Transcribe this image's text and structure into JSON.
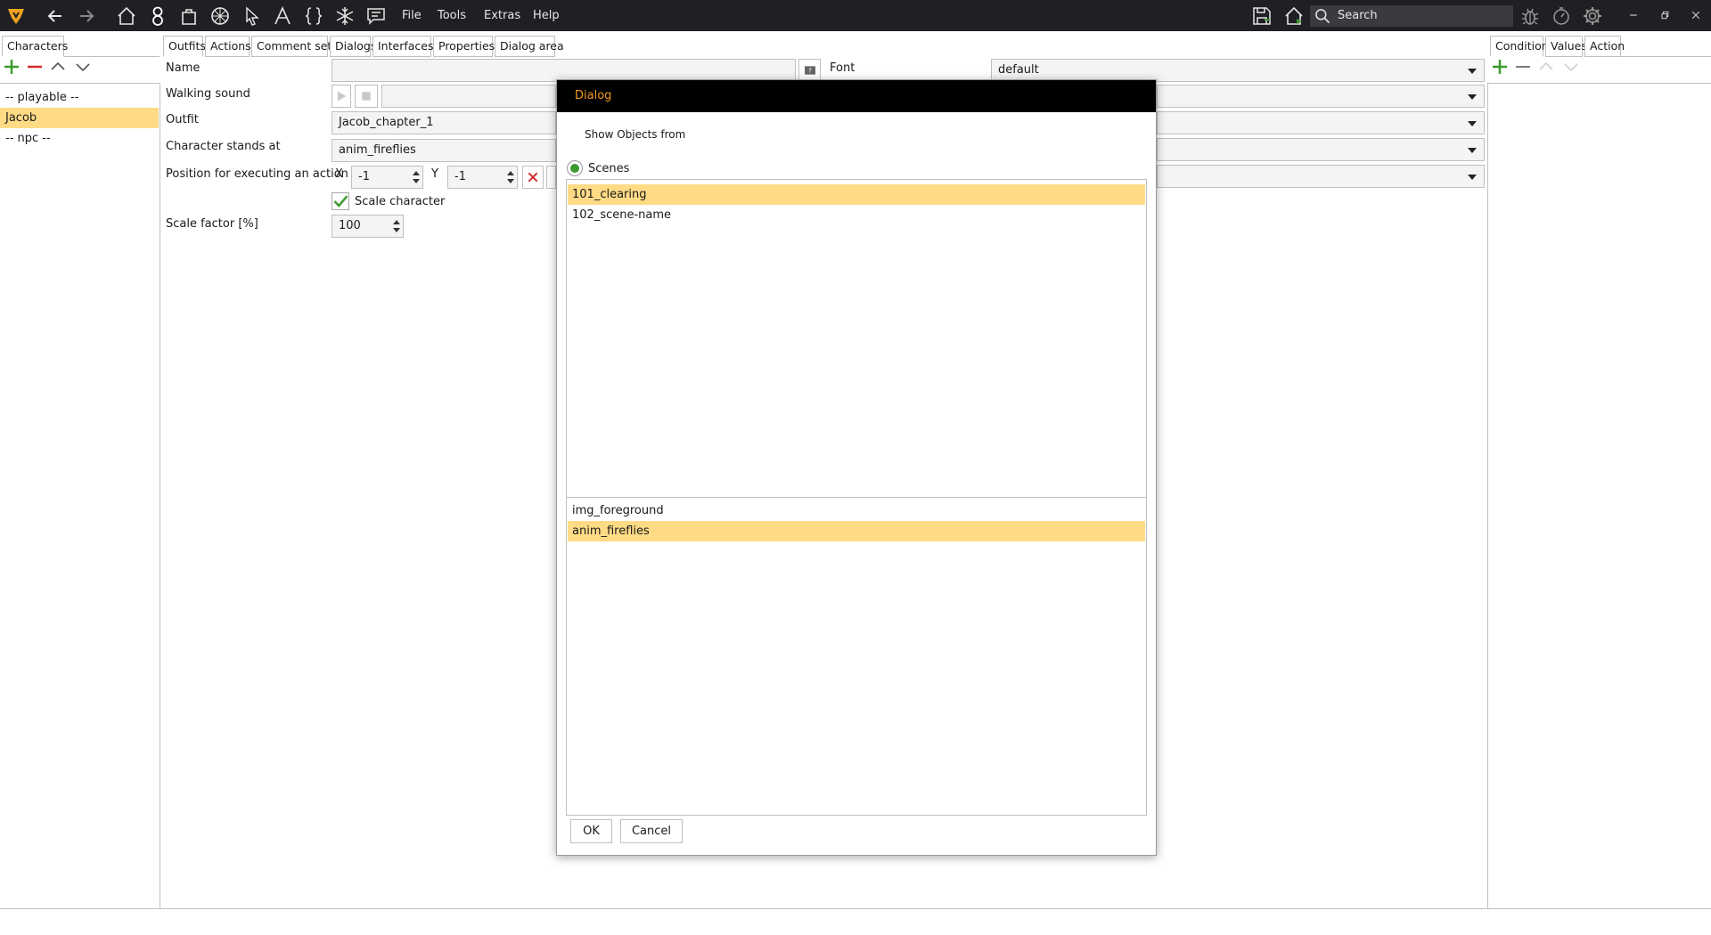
{
  "menu": {
    "file": "File",
    "tools": "Tools",
    "extras": "Extras",
    "help": "Help"
  },
  "search": {
    "placeholder": "Search"
  },
  "left_panel": {
    "tab": "Characters",
    "items": [
      {
        "label": "-- playable --"
      },
      {
        "label": "Jacob"
      },
      {
        "label": "-- npc --"
      }
    ]
  },
  "center_tabs": [
    "Outfits",
    "Actions",
    "Comment sets",
    "Dialogs",
    "Interfaces",
    "Properties",
    "Dialog area"
  ],
  "form": {
    "name_label": "Name",
    "name_value": "",
    "walking_sound_label": "Walking sound",
    "outfit_label": "Outfit",
    "outfit_value": "Jacob_chapter_1",
    "stands_at_label": "Character stands at",
    "stands_at_value": "anim_fireflies",
    "position_label": "Position for executing an action",
    "x_label": "X",
    "x_value": "-1",
    "y_label": "Y",
    "y_value": "-1",
    "scale_character_label": "Scale character",
    "scale_character_checked": true,
    "scale_factor_label": "Scale factor [%]",
    "scale_factor_value": "100",
    "font_label": "Font",
    "font_value": "default"
  },
  "right_panel": {
    "tabs": [
      "Conditions",
      "Values",
      "Action"
    ]
  },
  "dialog": {
    "title": "Dialog",
    "heading": "Show Objects from",
    "radio_label": "Scenes",
    "scenes": [
      "101_clearing",
      "102_scene-name"
    ],
    "objects": [
      "img_foreground",
      "anim_fireflies"
    ],
    "ok_label": "OK",
    "cancel_label": "Cancel"
  },
  "colors": {
    "accent_orange": "#f39a1e",
    "selection": "#ffdb85",
    "toolbar": "#1f2023",
    "add_green": "#3c9a2f",
    "remove_red": "#d42b2b"
  }
}
